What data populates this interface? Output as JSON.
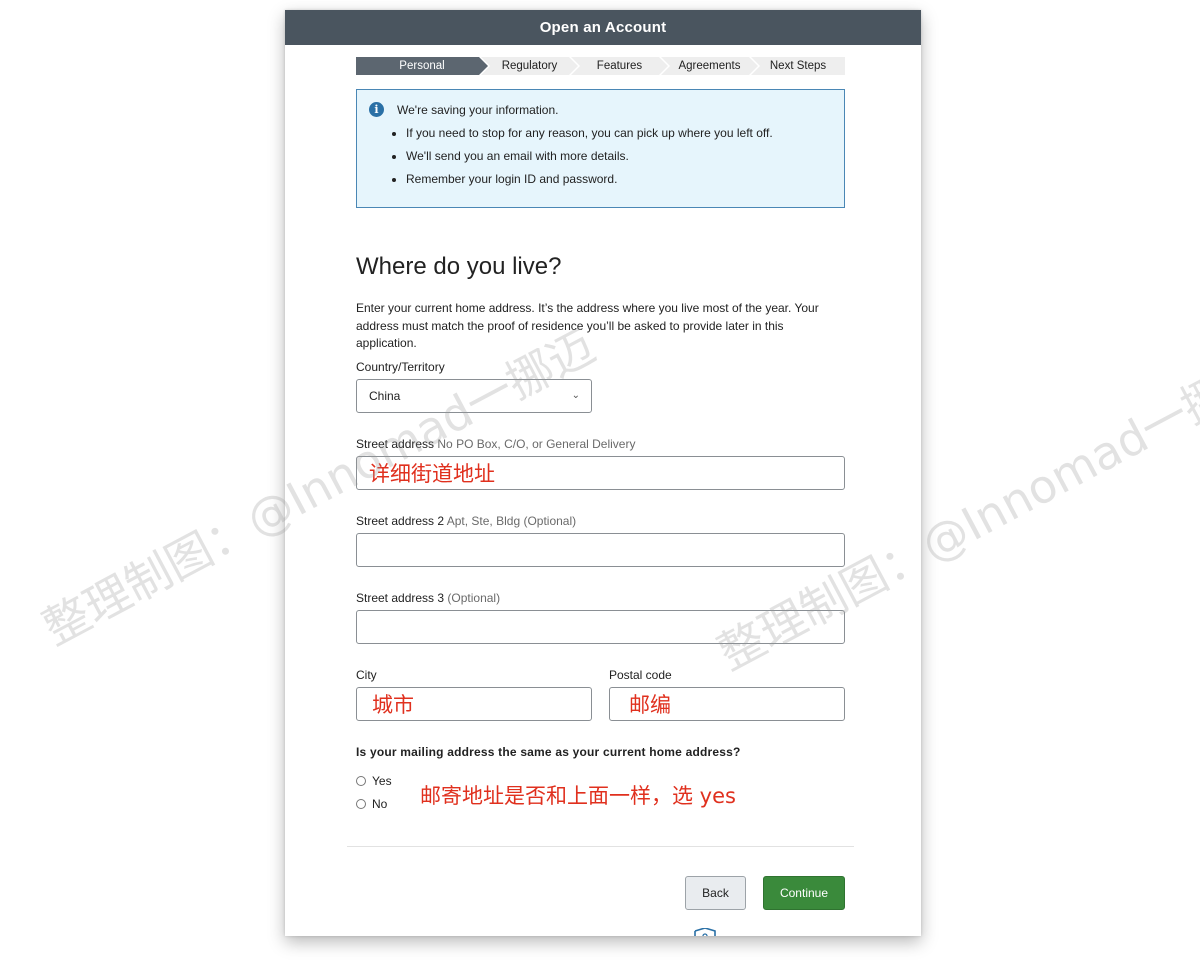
{
  "header": {
    "title": "Open an Account"
  },
  "steps": [
    "Personal",
    "Regulatory",
    "Features",
    "Agreements",
    "Next Steps"
  ],
  "info": {
    "title": "We're saving your information.",
    "bullets": [
      "If you need to stop for any reason, you can pick up where you left off.",
      "We'll send you an email with more details.",
      "Remember your login ID and password."
    ]
  },
  "page": {
    "heading": "Where do you live?",
    "description": "Enter your current home address. It’s the address where you live most of the year. Your address must match the proof of residence you’ll be asked to provide later in this application."
  },
  "form": {
    "country": {
      "label": "Country/Territory",
      "value": "China"
    },
    "street1": {
      "label": "Street address",
      "hint": "No PO Box, C/O, or General Delivery",
      "value": "详细街道地址"
    },
    "street2": {
      "label": "Street address 2",
      "hint": "Apt, Ste, Bldg (Optional)",
      "value": ""
    },
    "street3": {
      "label": "Street address 3",
      "hint": "(Optional)",
      "value": ""
    },
    "city": {
      "label": "City",
      "value": "城市"
    },
    "postal": {
      "label": "Postal code",
      "value": "邮编"
    },
    "mailing_question": "Is your mailing address the same as your current  home address?",
    "options": [
      "Yes",
      "No"
    ],
    "annotation": "邮寄地址是否和上面一样，选 yes"
  },
  "buttons": {
    "back": "Back",
    "continue": "Continue"
  },
  "watermark": "整理制图：@Innomad一挪迈",
  "colors": {
    "header": "#4a555f",
    "continue": "#3a8a3b",
    "annotation": "#e0301e",
    "info_bg": "#e6f5fc"
  }
}
